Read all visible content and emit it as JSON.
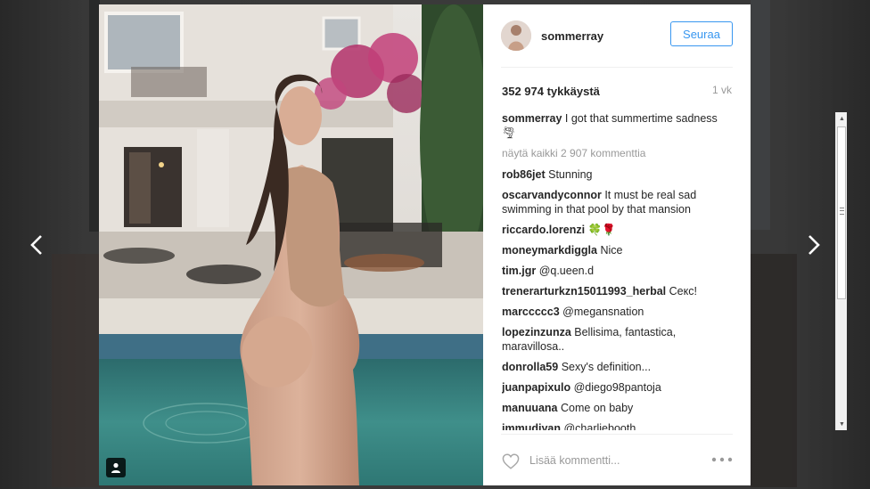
{
  "post": {
    "username": "sommerray",
    "follow_label": "Seuraa",
    "likes": "352 974 tykkäystä",
    "timestamp": "1 vk",
    "view_all": "näytä kaikki 2 907 kommenttia",
    "comment_placeholder": "Lisää kommentti...",
    "caption": {
      "user": "sommerray",
      "text": "I got that summertime sadness 🌪"
    },
    "comments": [
      {
        "user": "rob86jet",
        "text": "Stunning"
      },
      {
        "user": "oscarvandyconnor",
        "text": "It must be real sad swimming in that pool by that mansion"
      },
      {
        "user": "riccardo.lorenzi",
        "text": "🍀🌹"
      },
      {
        "user": "moneymarkdiggla",
        "text": "Nice"
      },
      {
        "user": "tim.jgr",
        "text": "@q.ueen.d"
      },
      {
        "user": "trenerarturkzn15011993_herbal",
        "text": "Секс!"
      },
      {
        "user": "marccccc3",
        "text": "@megansnation"
      },
      {
        "user": "lopezinzunza",
        "text": "Bellisima, fantastica, maravillosa.."
      },
      {
        "user": "donrolla59",
        "text": "Sexy's definition..."
      },
      {
        "user": "juanpapixulo",
        "text": "@diego98pantoja"
      },
      {
        "user": "manuuana",
        "text": "Come on baby"
      },
      {
        "user": "immudiyan",
        "text": "@charliebooth"
      }
    ]
  },
  "icons": {
    "prev": "chevron-left-icon",
    "next": "chevron-right-icon",
    "heart": "heart-outline-icon",
    "more": "more-dots-icon",
    "user_tag": "user-tag-icon"
  },
  "colors": {
    "accent": "#3897f0",
    "text": "#262626",
    "muted": "#999999"
  }
}
